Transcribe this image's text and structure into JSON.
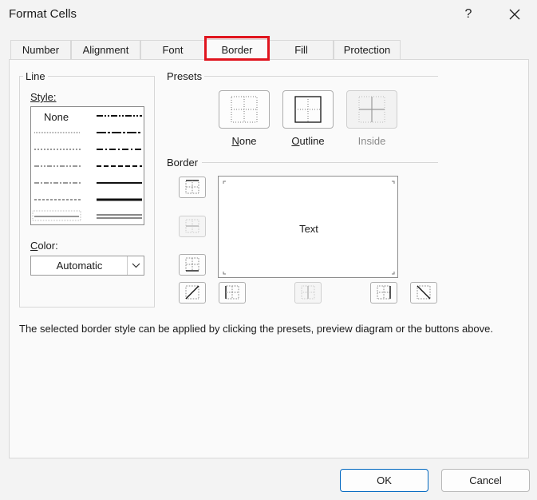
{
  "window": {
    "title": "Format Cells",
    "help": "?"
  },
  "tabs": [
    {
      "label": "Number"
    },
    {
      "label": "Alignment"
    },
    {
      "label": "Font"
    },
    {
      "label": "Border"
    },
    {
      "label": "Fill"
    },
    {
      "label": "Protection"
    }
  ],
  "line": {
    "group_label": "Line",
    "style_label": "Style:",
    "style_none": "None",
    "color_label": "Color:",
    "color_value": "Automatic"
  },
  "presets": {
    "group_label": "Presets",
    "items": [
      {
        "label": "None",
        "mnemonic": "N",
        "disabled": false
      },
      {
        "label": "Outline",
        "mnemonic": "O",
        "disabled": false
      },
      {
        "label": "Inside",
        "mnemonic": "",
        "disabled": true
      }
    ]
  },
  "border": {
    "group_label": "Border",
    "preview_text": "Text"
  },
  "info_text": "The selected border style can be applied by clicking the presets, preview diagram or the buttons above.",
  "buttons": {
    "ok": "OK",
    "cancel": "Cancel"
  },
  "colors": {
    "highlight": "#e0141e",
    "accent": "#0067c0"
  }
}
